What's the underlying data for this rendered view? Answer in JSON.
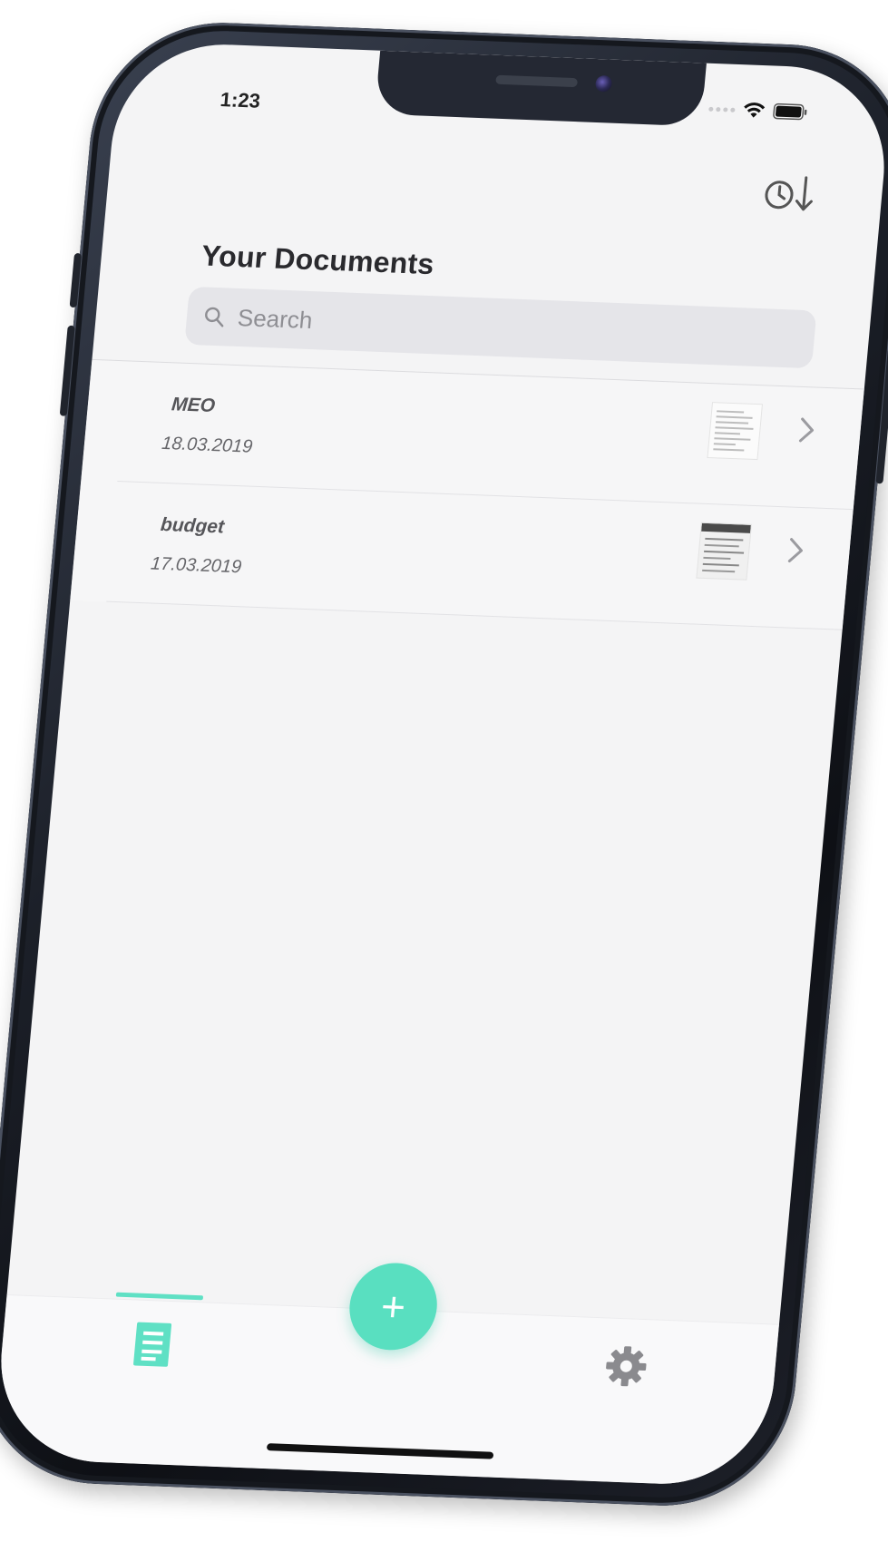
{
  "status_bar": {
    "time": "1:23"
  },
  "header": {
    "title": "Your Documents",
    "history_icon": "clock-sort-icon"
  },
  "search": {
    "placeholder": "Search",
    "value": ""
  },
  "documents": [
    {
      "title": "MEO",
      "date": "18.03.2019"
    },
    {
      "title": "budget",
      "date": "17.03.2019"
    }
  ],
  "tabbar": {
    "add_label": "+",
    "tabs": [
      {
        "icon": "document-list-icon",
        "active": true
      },
      {
        "icon": "gear-icon",
        "active": false
      }
    ]
  },
  "colors": {
    "accent": "#59dfc0",
    "tab_active": "#5fe0c4",
    "icon_inactive": "#8a8a8e"
  }
}
